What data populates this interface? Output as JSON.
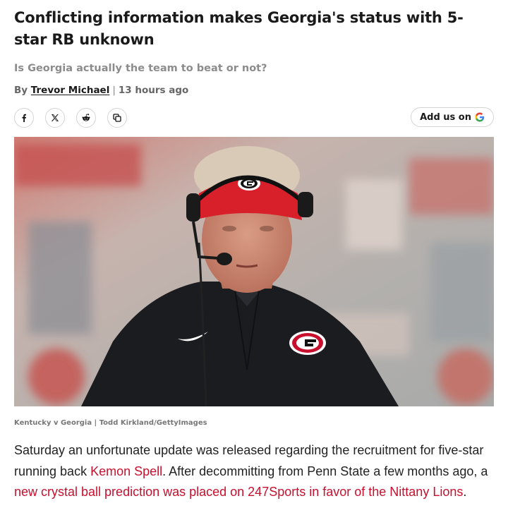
{
  "article": {
    "headline": "Conflicting information makes Georgia's status with 5-star RB unknown",
    "subheadline": "Is Georgia actually the team to beat or not?",
    "byline": {
      "prefix": "By",
      "author": "Trevor Michael",
      "separator": "|",
      "timestamp": "13 hours ago"
    },
    "share_buttons": [
      {
        "icon": "facebook-icon"
      },
      {
        "icon": "x-twitter-icon"
      },
      {
        "icon": "reddit-icon"
      },
      {
        "icon": "copy-link-icon"
      }
    ],
    "add_google": {
      "label": "Add us on",
      "icon": "google-icon"
    },
    "image_caption": "Kentucky v Georgia | Todd Kirkland/GettyImages",
    "paragraph": {
      "text1": "Saturday an unfortunate update was released regarding the recruitment for five-star running back ",
      "link1": "Kemon Spell",
      "text2": ". After decommitting from Penn State a few months ago, a ",
      "link2": "new crystal ball prediction was placed on 247Sports in favor of the Nittany Lions",
      "text3": "."
    },
    "colors": {
      "link": "#c8102e",
      "subhead": "#8c8c8c",
      "visor_red": "#d8202b"
    }
  }
}
